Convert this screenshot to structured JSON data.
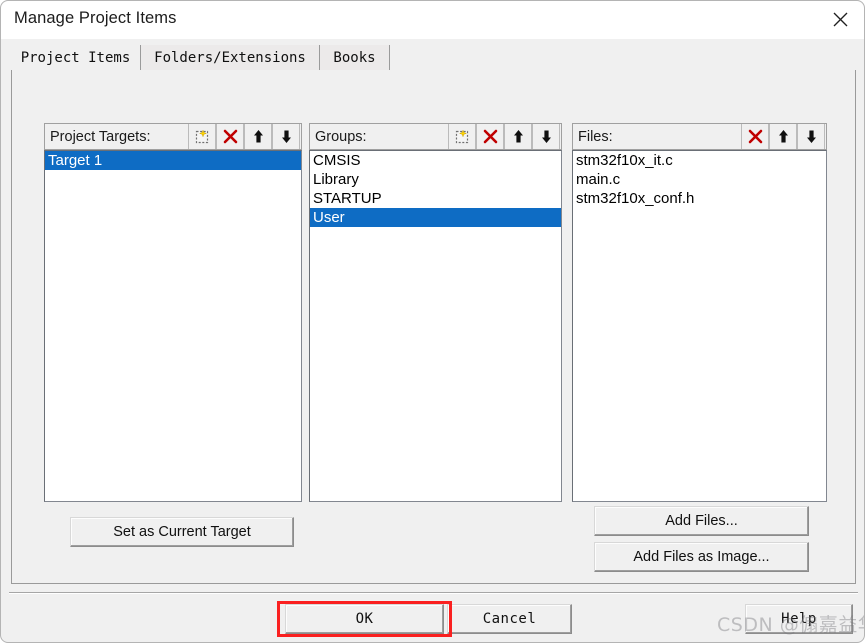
{
  "window": {
    "title": "Manage Project Items",
    "close_icon": "close-icon"
  },
  "tabs": [
    {
      "label": "Project Items",
      "active": true
    },
    {
      "label": "Folders/Extensions",
      "active": false
    },
    {
      "label": "Books",
      "active": false
    }
  ],
  "panels": {
    "targets": {
      "header": "Project Targets:",
      "tools": [
        "new-item-icon",
        "delete-icon",
        "move-up-icon",
        "move-down-icon"
      ],
      "items": [
        {
          "label": "Target 1",
          "selected": true
        }
      ]
    },
    "groups": {
      "header": "Groups:",
      "tools": [
        "new-item-icon",
        "delete-icon",
        "move-up-icon",
        "move-down-icon"
      ],
      "items": [
        {
          "label": "CMSIS",
          "selected": false
        },
        {
          "label": "Library",
          "selected": false
        },
        {
          "label": "STARTUP",
          "selected": false
        },
        {
          "label": "User",
          "selected": true
        }
      ]
    },
    "files": {
      "header": "Files:",
      "tools": [
        "delete-icon",
        "move-up-icon",
        "move-down-icon"
      ],
      "items": [
        {
          "label": "stm32f10x_it.c",
          "selected": false
        },
        {
          "label": "main.c",
          "selected": false
        },
        {
          "label": "stm32f10x_conf.h",
          "selected": false
        }
      ]
    }
  },
  "buttons": {
    "set_as_current_target": "Set as Current Target",
    "add_files": "Add Files...",
    "add_files_as_image": "Add Files as Image...",
    "ok": "OK",
    "cancel": "Cancel",
    "help": "Help"
  },
  "annotation": {
    "highlight_color": "#fa2020",
    "highlight_target": "ok-button"
  },
  "watermark": {
    "text": "CSDN @傓嘉益华"
  },
  "colors": {
    "selection_blue": "#0e6cc4",
    "dialog_background": "#f0f0f0",
    "titlebar_background": "#ffffff",
    "delete_icon_red": "#c00000"
  }
}
